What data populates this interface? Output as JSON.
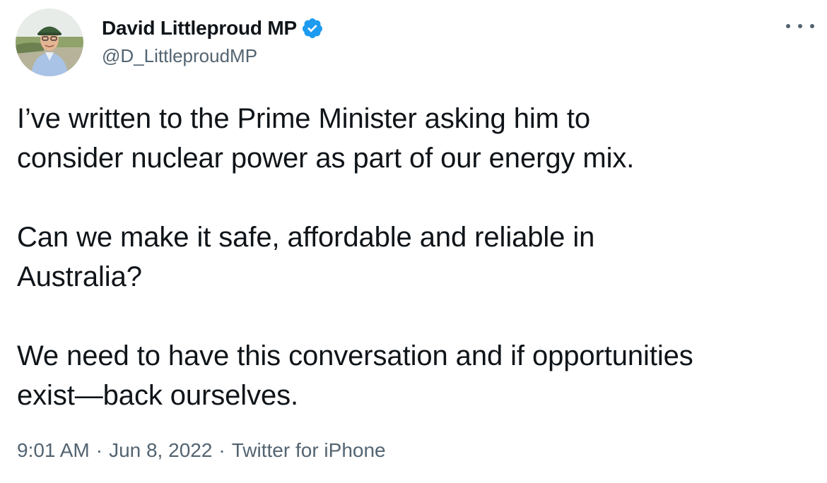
{
  "author": {
    "display_name": "David Littleproud MP",
    "handle": "@D_LittleproudMP",
    "verified": true,
    "avatar_icon": "profile-photo",
    "verified_icon": "verified-badge-icon"
  },
  "tweet": {
    "paragraphs": [
      [
        "I’ve written to the Prime Minister asking him to",
        "consider nuclear power as part of our energy mix."
      ],
      [
        "Can we make it safe, affordable and reliable in",
        "Australia?"
      ],
      [
        "We need to have this conversation and if opportunities",
        "exist—back ourselves."
      ]
    ],
    "time": "9:01 AM",
    "separator": "·",
    "date": "Jun 8, 2022",
    "source": "Twitter for iPhone"
  },
  "more_icon": "more-options-icon",
  "colors": {
    "text": "#0f1419",
    "secondary": "#536471",
    "verified": "#1d9bf0",
    "background": "#ffffff"
  }
}
